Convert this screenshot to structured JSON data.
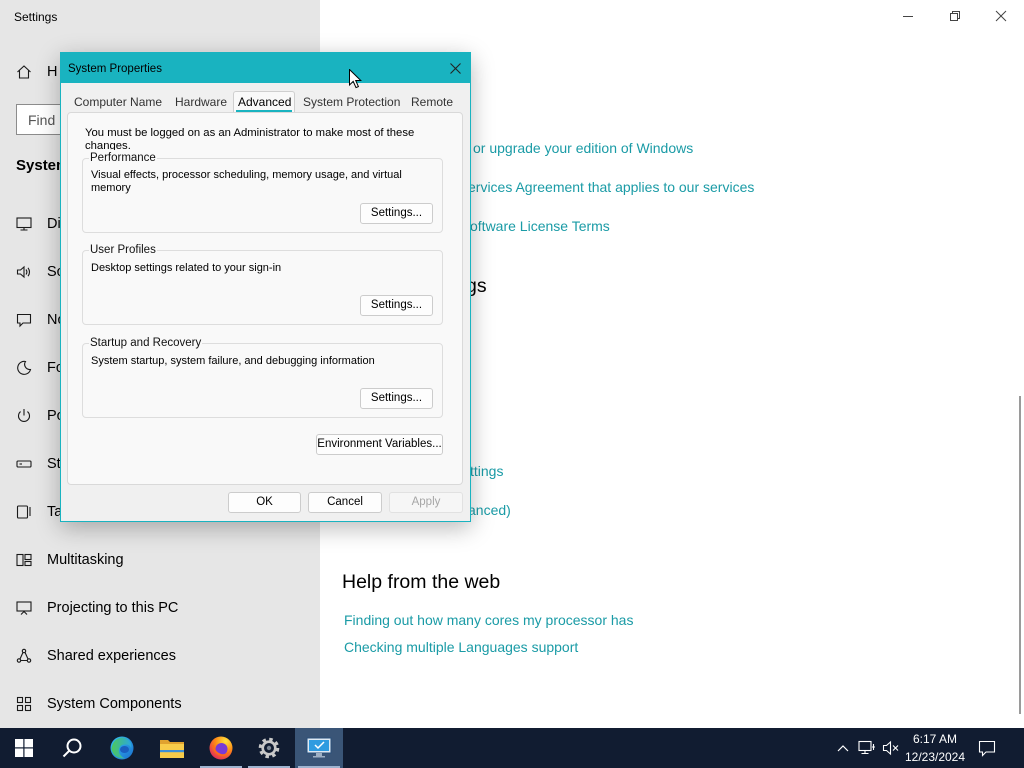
{
  "window": {
    "title": "Settings"
  },
  "sidebar": {
    "home": {
      "icon": "home-icon",
      "label": "H"
    },
    "search": {
      "placeholder": "Find"
    },
    "section_title": "System",
    "items": [
      {
        "icon": "display-icon",
        "label": "Di"
      },
      {
        "icon": "sound-icon",
        "label": "So"
      },
      {
        "icon": "notifications-icon",
        "label": "No"
      },
      {
        "icon": "focus-assist-icon",
        "label": "Fo"
      },
      {
        "icon": "power-icon",
        "label": "Po"
      },
      {
        "icon": "storage-icon",
        "label": "St"
      },
      {
        "icon": "tablet-icon",
        "label": "Ta"
      },
      {
        "icon": "multitasking-icon",
        "label": "Multitasking"
      },
      {
        "icon": "projecting-icon",
        "label": "Projecting to this PC"
      },
      {
        "icon": "shared-experiences-icon",
        "label": "Shared experiences"
      },
      {
        "icon": "system-components-icon",
        "label": "System Components"
      }
    ]
  },
  "main": {
    "top_links": [
      "or upgrade your edition of Windows",
      "ervices Agreement that applies to our services",
      "oftware License Terms"
    ],
    "related_heading": "gs",
    "related_links": [
      "ttings",
      "anced)"
    ],
    "help": {
      "heading": "Help from the web",
      "links": [
        "Finding out how many cores my processor has",
        "Checking multiple Languages support"
      ]
    }
  },
  "dialog": {
    "title": "System Properties",
    "tabs": [
      {
        "label": "Computer Name",
        "selected": false
      },
      {
        "label": "Hardware",
        "selected": false
      },
      {
        "label": "Advanced",
        "selected": true
      },
      {
        "label": "System Protection",
        "selected": false
      },
      {
        "label": "Remote",
        "selected": false
      }
    ],
    "notice_lines": [
      "You must be logged on as an Administrator to make most of these",
      "changes."
    ],
    "groups": [
      {
        "title": "Performance",
        "description_lines": [
          "Visual effects, processor scheduling, memory usage, and virtual",
          "memory"
        ],
        "button": "Settings..."
      },
      {
        "title": "User Profiles",
        "description_lines": [
          "Desktop settings related to your sign-in"
        ],
        "button": "Settings..."
      },
      {
        "title": "Startup and Recovery",
        "description_lines": [
          "System startup, system failure, and debugging information"
        ],
        "button": "Settings..."
      }
    ],
    "environment_button": "Environment Variables...",
    "footer_buttons": {
      "ok": "OK",
      "cancel": "Cancel",
      "apply": "Apply",
      "apply_enabled": false
    }
  },
  "taskbar": {
    "pinned": [
      {
        "icon": "windows-start-icon",
        "running": false,
        "active": false
      },
      {
        "icon": "search-icon",
        "running": false,
        "active": false
      },
      {
        "icon": "edge-browser-icon",
        "running": false,
        "active": false
      },
      {
        "icon": "file-explorer-icon",
        "running": false,
        "active": false
      },
      {
        "icon": "firefox-icon",
        "running": true,
        "active": false
      },
      {
        "icon": "settings-gear-icon",
        "running": true,
        "active": false
      },
      {
        "icon": "system-properties-icon",
        "running": true,
        "active": true
      }
    ],
    "tray": {
      "icons": [
        "chevron-up-icon",
        "network-icon",
        "volume-muted-icon",
        "notification-icon"
      ],
      "time": "6:17 AM",
      "date": "12/23/2024"
    }
  },
  "colors": {
    "accent": "#19b3c0",
    "link": "#1a9ba6",
    "taskbar": "#111c31",
    "sidebar": "#e6e6e6"
  }
}
